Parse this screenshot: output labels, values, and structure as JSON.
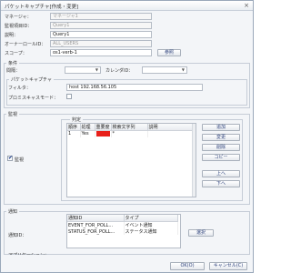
{
  "window": {
    "title": "パケットキャプチャ[作成・変更]",
    "close_glyph": "×"
  },
  "fields": {
    "manager_label": "マネージャ：",
    "manager_value": "マネージャ1",
    "monitor_id_label": "監視項目ID：",
    "monitor_id_value": "Query1",
    "description_label": "説明：",
    "description_value": "Query1",
    "owner_role_label": "オーナーロールID：",
    "owner_role_value": "ALL_USERS",
    "scope_label": "スコープ：",
    "scope_value": "os1-verb-1",
    "scope_button": "参照"
  },
  "condition": {
    "group_title": "条件",
    "interval_label": "間隔：",
    "interval_value": "",
    "calendar_label": "カレンダID：",
    "calendar_value": ""
  },
  "packet_capture": {
    "group_title": "パケットキャプチャ",
    "filter_label": "フィルタ：",
    "filter_value": "host 192.168.56.105",
    "promiscuous_label": "プロミスキャスモード："
  },
  "monitor": {
    "group_title": "監視",
    "judge_title": "判定",
    "enabled_label": "監視",
    "columns": [
      "順序",
      "処理",
      "重要度",
      "検索文字列",
      "説明"
    ],
    "rows": [
      {
        "order": "1",
        "action": "Yes",
        "severity": "",
        "pattern": "*",
        "description": ""
      }
    ],
    "severity_color": "#e8201a",
    "buttons": {
      "add": "追加",
      "edit": "変更",
      "delete": "削除",
      "copy": "コピー",
      "up": "上へ",
      "down": "下へ"
    }
  },
  "notify": {
    "group_title": "通知",
    "notify_id_label": "通知ID：",
    "columns": [
      "通知ID",
      "タイプ"
    ],
    "rows": [
      {
        "id": "EVENT_FOR_POLL...",
        "type": "イベント通知"
      },
      {
        "id": "STATUS_FOR_POLL...",
        "type": "ステータス通知"
      }
    ],
    "select_button": "選択",
    "application_label": "アプリケーション：",
    "application_value": "Packet"
  },
  "footer": {
    "ok": "OK(O)",
    "cancel": "キャンセル(C)"
  }
}
